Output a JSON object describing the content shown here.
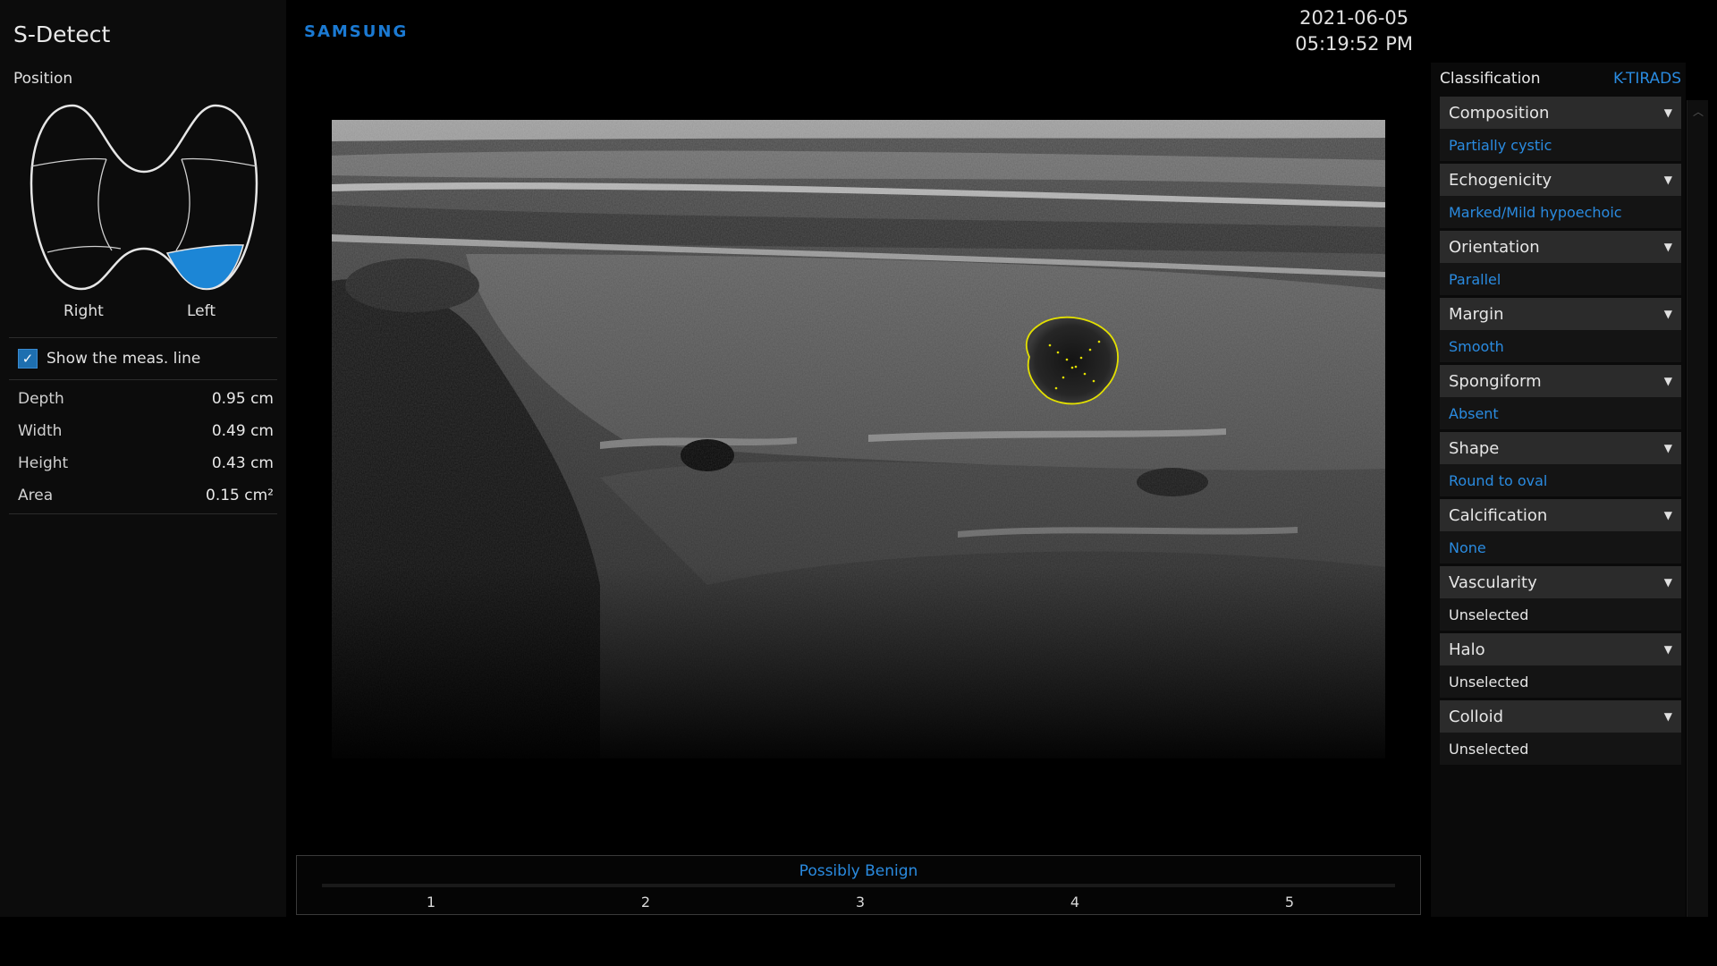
{
  "app": {
    "title": "S-Detect",
    "brand": "SAMSUNG"
  },
  "datetime": {
    "date": "2021-06-05",
    "time": "05:19:52 PM"
  },
  "position": {
    "label": "Position",
    "right_label": "Right",
    "left_label": "Left",
    "selected": "Left"
  },
  "meas_line": {
    "label": "Show the meas. line",
    "checked": true
  },
  "measurements": [
    {
      "label": "Depth",
      "value": "0.95",
      "unit": "cm"
    },
    {
      "label": "Width",
      "value": "0.49",
      "unit": "cm"
    },
    {
      "label": "Height",
      "value": "0.43",
      "unit": "cm"
    },
    {
      "label": "Area",
      "value": "0.15",
      "unit": "cm²"
    }
  ],
  "classification": {
    "label": "Classification",
    "system": "K-TIRADS",
    "features": [
      {
        "name": "Composition",
        "value": "Partially cystic",
        "selected": true
      },
      {
        "name": "Echogenicity",
        "value": "Marked/Mild hypoechoic",
        "selected": true
      },
      {
        "name": "Orientation",
        "value": "Parallel",
        "selected": true
      },
      {
        "name": "Margin",
        "value": "Smooth",
        "selected": true
      },
      {
        "name": "Spongiform",
        "value": "Absent",
        "selected": true
      },
      {
        "name": "Shape",
        "value": "Round to oval",
        "selected": true
      },
      {
        "name": "Calcification",
        "value": "None",
        "selected": true
      },
      {
        "name": "Vascularity",
        "value": "Unselected",
        "selected": false
      },
      {
        "name": "Halo",
        "value": "Unselected",
        "selected": false
      },
      {
        "name": "Colloid",
        "value": "Unselected",
        "selected": false
      }
    ]
  },
  "result": {
    "label": "Possibly Benign",
    "scale": [
      "1",
      "2",
      "3",
      "4",
      "5"
    ]
  },
  "colors": {
    "accent": "#2a8be0",
    "brand": "#1b7ad3",
    "lesion_outline": "#e3e000",
    "selected_lobe": "#1c86d6"
  },
  "icons": {
    "dropdown": "caret-down-icon",
    "check": "checkmark-icon",
    "scroll": "scroll-up-icon"
  }
}
